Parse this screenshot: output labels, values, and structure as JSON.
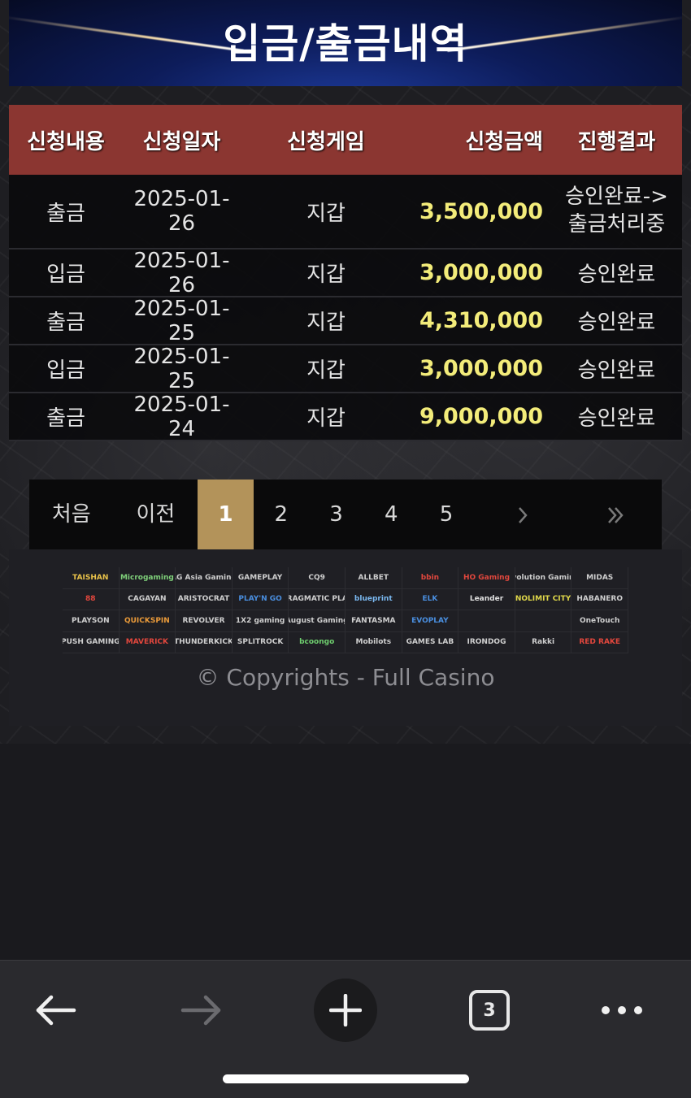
{
  "header": {
    "title": "입금/출금내역"
  },
  "table": {
    "columns": [
      "신청내용",
      "신청일자",
      "신청게임",
      "신청금액",
      "진행결과"
    ],
    "rows": [
      {
        "type": "출금",
        "date": "2025-01-26",
        "game": "지갑",
        "amount": "3,500,000",
        "status_line1": "승인완료->",
        "status_line2": "출금처리중"
      },
      {
        "type": "입금",
        "date": "2025-01-26",
        "game": "지갑",
        "amount": "3,000,000",
        "status": "승인완료"
      },
      {
        "type": "출금",
        "date": "2025-01-25",
        "game": "지갑",
        "amount": "4,310,000",
        "status": "승인완료"
      },
      {
        "type": "입금",
        "date": "2025-01-25",
        "game": "지갑",
        "amount": "3,000,000",
        "status": "승인완료"
      },
      {
        "type": "출금",
        "date": "2025-01-24",
        "game": "지갑",
        "amount": "9,000,000",
        "status": "승인완료"
      }
    ]
  },
  "pagination": {
    "first": "처음",
    "prev": "이전",
    "pages": [
      "1",
      "2",
      "3",
      "4",
      "5"
    ],
    "current": "1",
    "next_icon": "chevron-right",
    "last_icon": "double-chevron-right"
  },
  "footer": {
    "providers": [
      "TAISHAN",
      "Microgaming",
      "AG Asia Gaming",
      "GAMEPLAY",
      "CQ9",
      "ALLBET",
      "bbin",
      "HO Gaming",
      "Evolution Gaming",
      "MIDAS",
      "88",
      "CAGAYAN",
      "ARISTOCRAT",
      "PLAY'N GO",
      "PRAGMATIC PLAY",
      "blueprint",
      "ELK",
      "Leander",
      "NOLIMIT CITY",
      "HABANERO",
      "PLAYSON",
      "QUICKSPIN",
      "REVOLVER",
      "1X2 gaming",
      "August Gaming",
      "FANTASMA",
      "EVOPLAY",
      "",
      "",
      "OneTouch",
      "PUSH GAMING",
      "MAVERICK",
      "THUNDERKICK",
      "SPLITROCK",
      "bcoongo",
      "Mobilots",
      "GAMES LAB",
      "IRONDOG",
      "Rakki",
      "RED RAKE"
    ],
    "copyright": "© Copyrights - Full Casino"
  },
  "browser": {
    "tab_count": "3"
  },
  "colors": {
    "header_row": "#8b3631",
    "amount": "#f3ec7a",
    "active_page": "#b3935a"
  }
}
